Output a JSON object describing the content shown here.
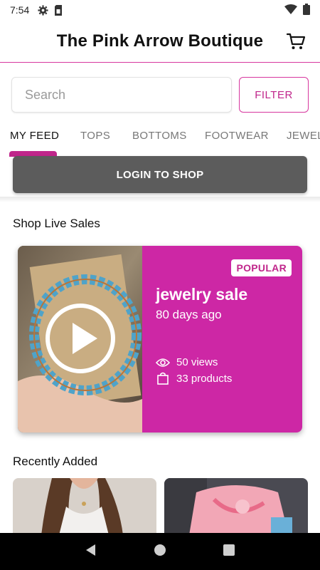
{
  "status_bar": {
    "time": "7:54",
    "icons": [
      "gear-icon",
      "sim-card-icon",
      "wifi-icon",
      "battery-icon"
    ]
  },
  "header": {
    "title": "The Pink Arrow Boutique",
    "cart_icon": "cart-icon"
  },
  "search": {
    "placeholder": "Search",
    "value": "",
    "filter_label": "FILTER"
  },
  "tabs": [
    {
      "label": "MY FEED",
      "active": true
    },
    {
      "label": "TOPS",
      "active": false
    },
    {
      "label": "BOTTOMS",
      "active": false
    },
    {
      "label": "FOOTWEAR",
      "active": false
    },
    {
      "label": "JEWEL",
      "active": false
    }
  ],
  "login": {
    "label": "LOGIN TO SHOP"
  },
  "live_sales": {
    "section_title": "Shop Live Sales",
    "card": {
      "badge": "POPULAR",
      "title": "jewelry sale",
      "age": "80 days ago",
      "views": "50 views",
      "products": "33 products",
      "thumb_icon": "play-icon"
    }
  },
  "recently_added": {
    "section_title": "Recently Added"
  },
  "colors": {
    "accent": "#c0268b",
    "card_bg": "#cd27a5",
    "login_bg": "#5c5c5c"
  },
  "nav_bar": {
    "icons": [
      "back-icon",
      "home-icon",
      "recents-icon"
    ]
  }
}
